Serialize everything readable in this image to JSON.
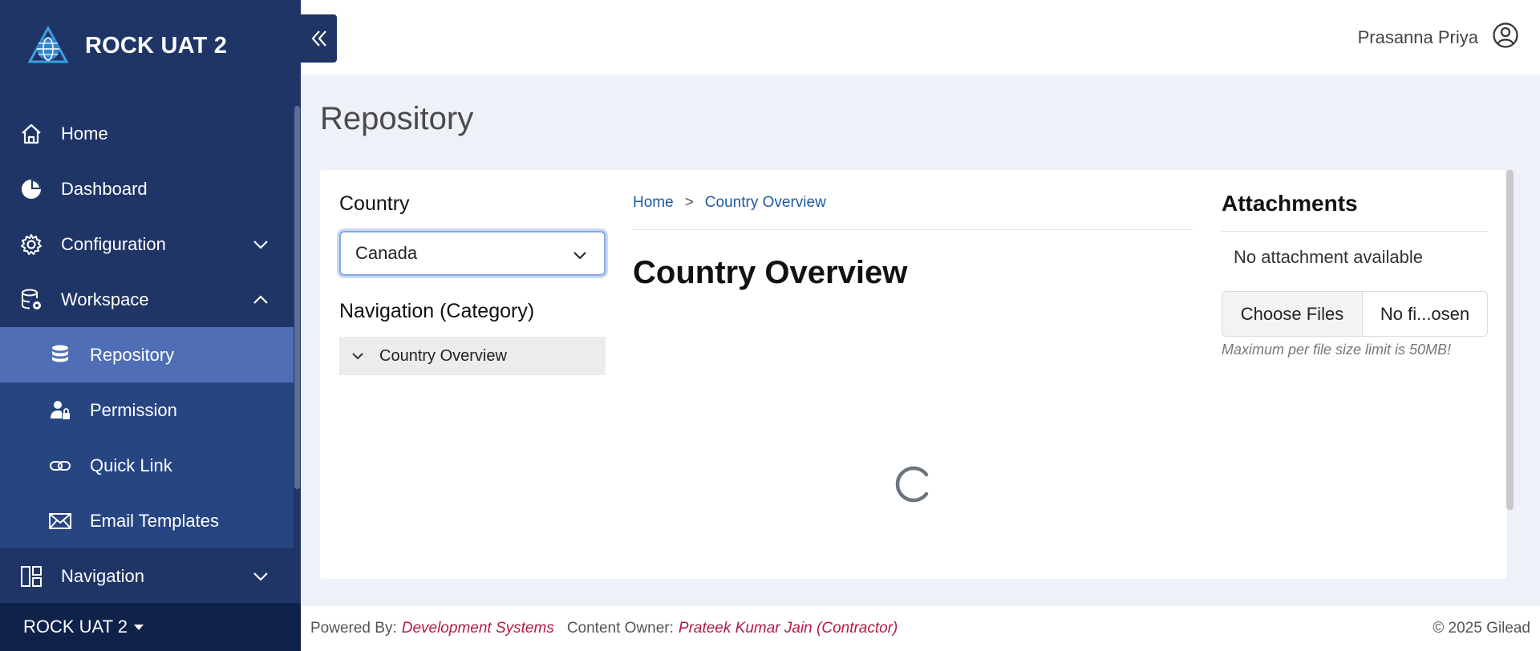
{
  "brand": {
    "title": "ROCK UAT 2"
  },
  "sidebar": {
    "items": [
      {
        "label": "Home",
        "icon": "home-icon"
      },
      {
        "label": "Dashboard",
        "icon": "pie-chart-icon"
      },
      {
        "label": "Configuration",
        "icon": "gear-icon"
      },
      {
        "label": "Workspace",
        "icon": "database-gear-icon"
      },
      {
        "label": "Navigation",
        "icon": "layout-icon"
      }
    ],
    "workspace_sub": [
      {
        "label": "Repository",
        "icon": "database-icon",
        "active": true
      },
      {
        "label": "Permission",
        "icon": "user-lock-icon"
      },
      {
        "label": "Quick Link",
        "icon": "link-icon"
      },
      {
        "label": "Email Templates",
        "icon": "envelope-icon"
      }
    ],
    "footer_label": "ROCK UAT 2"
  },
  "topbar": {
    "user_name": "Prasanna Priya"
  },
  "page": {
    "title": "Repository"
  },
  "left": {
    "country_label": "Country",
    "country_value": "Canada",
    "nav_label": "Navigation (Category)",
    "tree_item": "Country Overview"
  },
  "middle": {
    "breadcrumb": [
      "Home",
      ">",
      "Country Overview"
    ],
    "title": "Country Overview"
  },
  "attachments": {
    "title": "Attachments",
    "empty": "No attachment available",
    "choose_label": "Choose Files",
    "file_name": "No fi...osen",
    "note": "Maximum per file size limit is 50MB!"
  },
  "footer": {
    "powered_label": "Powered By:",
    "powered_value": "Development Systems",
    "owner_label": "Content Owner:",
    "owner_value": "Prateek Kumar Jain (Contractor)",
    "copyright": "© 2025 Gilead"
  },
  "colors": {
    "sidebar": "#1f3566",
    "active": "#4f6eb6",
    "link": "#1e5aa0",
    "accent": "#b01c46"
  }
}
